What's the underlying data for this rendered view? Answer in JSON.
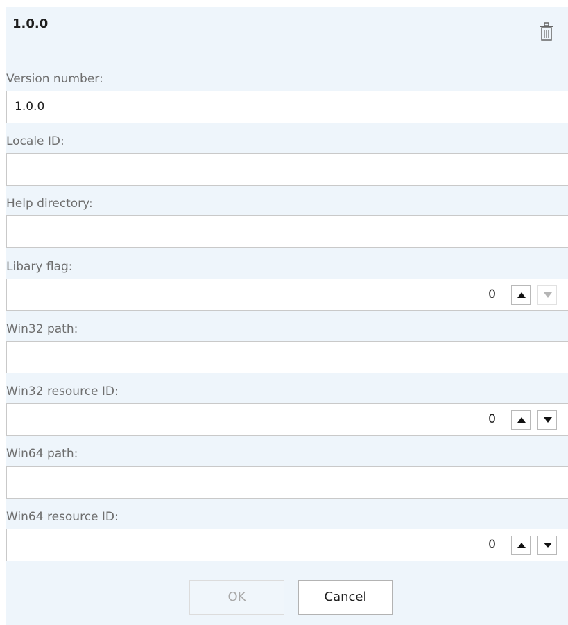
{
  "header": {
    "title": "1.0.0",
    "delete_icon": "trash-icon"
  },
  "fields": {
    "version_number": {
      "label": "Version number:",
      "value": "1.0.0"
    },
    "locale_id": {
      "label": "Locale ID:",
      "value": ""
    },
    "help_directory": {
      "label": "Help directory:",
      "value": ""
    },
    "library_flag": {
      "label": "Libary flag:",
      "value": "0",
      "down_enabled": false
    },
    "win32_path": {
      "label": "Win32 path:",
      "value": ""
    },
    "win32_resource_id": {
      "label": "Win32 resource ID:",
      "value": "0",
      "down_enabled": true
    },
    "win64_path": {
      "label": "Win64 path:",
      "value": ""
    },
    "win64_resource_id": {
      "label": "Win64 resource ID:",
      "value": "0",
      "down_enabled": true
    }
  },
  "footer": {
    "ok_label": "OK",
    "cancel_label": "Cancel"
  },
  "colors": {
    "panel_background": "#eef5fb",
    "label_text": "#6e6e6e",
    "disabled_text": "#a9a9a9"
  }
}
